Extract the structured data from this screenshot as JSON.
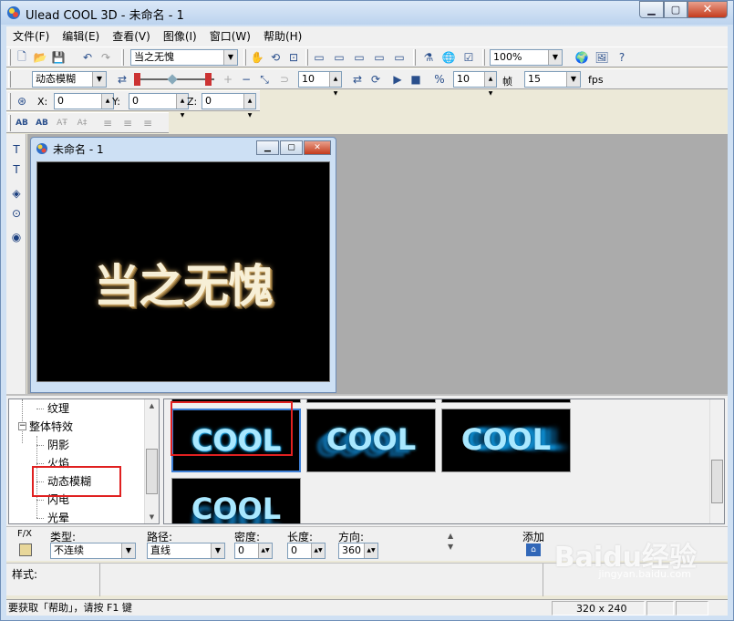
{
  "window": {
    "title": "Ulead COOL 3D - 未命名 - 1"
  },
  "menu": [
    "文件(F)",
    "编辑(E)",
    "查看(V)",
    "图像(I)",
    "窗口(W)",
    "帮助(H)"
  ],
  "toolbar1": {
    "text_combo": "当之无愧",
    "zoom_combo": "100%"
  },
  "toolbar2": {
    "effect_combo": "动态模糊",
    "frame_value": "10",
    "frame_count_value": "10",
    "frame_label": "帧",
    "fps_value": "15",
    "fps_label": "fps"
  },
  "toolbar3": {
    "x_label": "X:",
    "x_value": "0",
    "y_label": "Y:",
    "y_value": "0",
    "z_label": "Z:",
    "z_value": "0"
  },
  "document": {
    "title": "未命名 - 1",
    "canvas_text": "当之无愧"
  },
  "tree": {
    "items": [
      {
        "label": "纹理",
        "level": 1
      },
      {
        "label": "整体特效",
        "level": 0,
        "expanded": true
      },
      {
        "label": "阴影",
        "level": 1
      },
      {
        "label": "火焰",
        "level": 1
      },
      {
        "label": "动态模糊",
        "level": 1,
        "selected": true
      },
      {
        "label": "闪电",
        "level": 1
      },
      {
        "label": "光晕",
        "level": 1
      }
    ]
  },
  "gallery": {
    "thumb_text": "COOL"
  },
  "properties": {
    "fx_label": "F/X",
    "type_label": "类型:",
    "type_value": "不连续",
    "path_label": "路径:",
    "path_value": "直线",
    "density_label": "密度:",
    "density_value": "0",
    "length_label": "长度:",
    "length_value": "0",
    "direction_label": "方向:",
    "direction_value": "360",
    "add_label": "添加"
  },
  "style_row": {
    "label": "样式:"
  },
  "status": {
    "help_text": "要获取「帮助」，请按 F1 键",
    "size": "320 x 240"
  },
  "watermark": {
    "text": "Baidu经验",
    "sub": "jingyan.baidu.com"
  }
}
